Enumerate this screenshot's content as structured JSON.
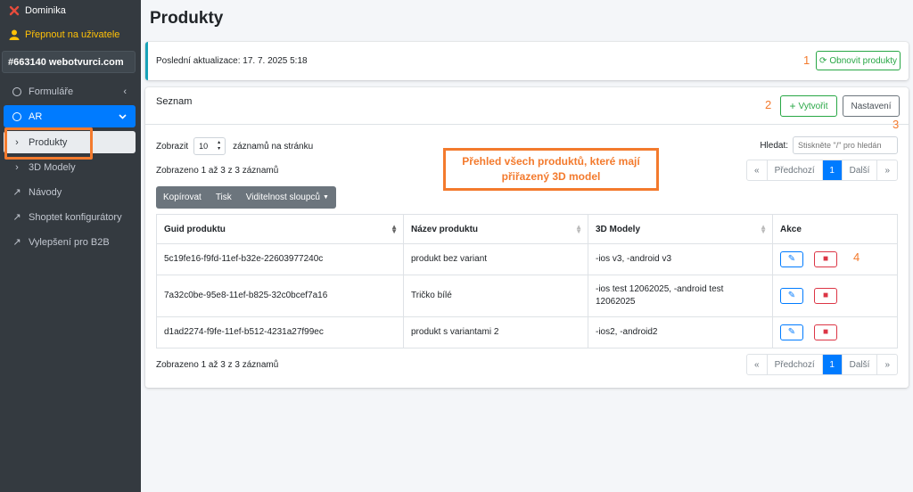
{
  "sidebar": {
    "user_name": "Dominika",
    "switch_user": "Přepnout na uživatele",
    "shop": "#663140 webotvurci.com",
    "items": [
      {
        "label": "Formuláře"
      },
      {
        "label": "AR"
      },
      {
        "label": "Produkty"
      },
      {
        "label": "3D Modely"
      },
      {
        "label": "Návody"
      },
      {
        "label": "Shoptet konfigurátory"
      },
      {
        "label": "Vylepšení pro B2B"
      }
    ]
  },
  "page": {
    "title": "Produkty"
  },
  "update": {
    "text": "Poslední aktualizace: 17. 7. 2025 5:18",
    "refresh_label": "Obnovit produkty"
  },
  "list": {
    "title": "Seznam",
    "create_label": "Vytvořit",
    "settings_label": "Nastavení",
    "show_label": "Zobrazit",
    "page_size": "10",
    "per_page_label": "záznamů na stránku",
    "search_label": "Hledat:",
    "search_placeholder": "Stiskněte \"/\" pro hledán",
    "info": "Zobrazeno 1 až 3 z 3 záznamů",
    "pager": {
      "first": "«",
      "prev": "Předchozí",
      "current": "1",
      "next": "Další",
      "last": "»"
    },
    "toolbar": {
      "copy": "Kopírovat",
      "print": "Tisk",
      "columns": "Viditelnost sloupců"
    },
    "columns": [
      "Guid produktu",
      "Název produktu",
      "3D Modely",
      "Akce"
    ],
    "rows": [
      {
        "guid": "5c19fe16-f9fd-11ef-b32e-22603977240c",
        "name": "produkt bez variant",
        "models": "-ios v3, -android v3"
      },
      {
        "guid": "7a32c0be-95e8-11ef-b825-32c0bcef7a16",
        "name": "Tričko bílé",
        "models": "-ios test 12062025, -android test 12062025"
      },
      {
        "guid": "d1ad2274-f9fe-11ef-b512-4231a27f99ec",
        "name": "produkt s variantami 2",
        "models": "-ios2, -android2"
      }
    ]
  },
  "annotations": {
    "callout": "Přehled všech produktů, které mají přiřazený 3D model",
    "markers": [
      "1",
      "2",
      "3",
      "4"
    ]
  },
  "colors": {
    "accent_orange": "#f37a2d",
    "primary": "#007bff",
    "success": "#28a745",
    "danger": "#dc3545",
    "sidebar_bg": "#343a40"
  }
}
